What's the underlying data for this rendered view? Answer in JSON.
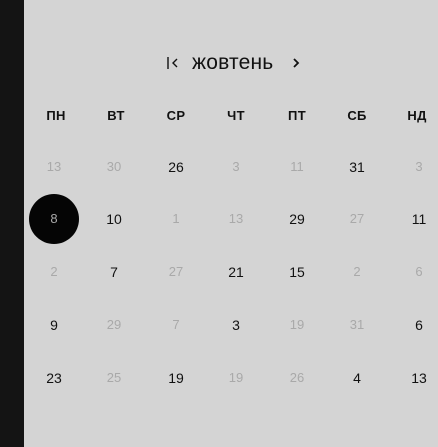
{
  "calendar": {
    "month_title": "жовтень",
    "weekdays": [
      "ПН",
      "ВТ",
      "СР",
      "ЧТ",
      "ПТ",
      "СБ",
      "НД"
    ],
    "weeks": [
      [
        {
          "label": "13",
          "muted": true
        },
        {
          "label": "30",
          "muted": true
        },
        {
          "label": "26",
          "muted": false
        },
        {
          "label": "3",
          "muted": true
        },
        {
          "label": "11",
          "muted": true
        },
        {
          "label": "31",
          "muted": false
        },
        {
          "label": "3",
          "muted": true
        }
      ],
      [
        {
          "label": "8",
          "muted": false,
          "selected": true
        },
        {
          "label": "10",
          "muted": false
        },
        {
          "label": "1",
          "muted": true
        },
        {
          "label": "13",
          "muted": true
        },
        {
          "label": "29",
          "muted": false
        },
        {
          "label": "27",
          "muted": true
        },
        {
          "label": "11",
          "muted": false
        }
      ],
      [
        {
          "label": "2",
          "muted": true
        },
        {
          "label": "7",
          "muted": false
        },
        {
          "label": "27",
          "muted": true
        },
        {
          "label": "21",
          "muted": false
        },
        {
          "label": "15",
          "muted": false
        },
        {
          "label": "2",
          "muted": true
        },
        {
          "label": "6",
          "muted": true
        }
      ],
      [
        {
          "label": "9",
          "muted": false
        },
        {
          "label": "29",
          "muted": true
        },
        {
          "label": "7",
          "muted": true
        },
        {
          "label": "3",
          "muted": false
        },
        {
          "label": "19",
          "muted": true
        },
        {
          "label": "31",
          "muted": true
        },
        {
          "label": "6",
          "muted": false
        }
      ],
      [
        {
          "label": "23",
          "muted": false
        },
        {
          "label": "25",
          "muted": true
        },
        {
          "label": "19",
          "muted": false
        },
        {
          "label": "19",
          "muted": true
        },
        {
          "label": "26",
          "muted": true
        },
        {
          "label": "4",
          "muted": false
        },
        {
          "label": "13",
          "muted": false
        }
      ]
    ]
  },
  "icons": {
    "first": "first-page-icon",
    "next": "chevron-right-icon"
  },
  "colors": {
    "background": "#d4d4d4",
    "left_bar": "#141414",
    "text": "#111111",
    "muted_text": "#a9a9a9",
    "selected_fill": "#050505"
  }
}
